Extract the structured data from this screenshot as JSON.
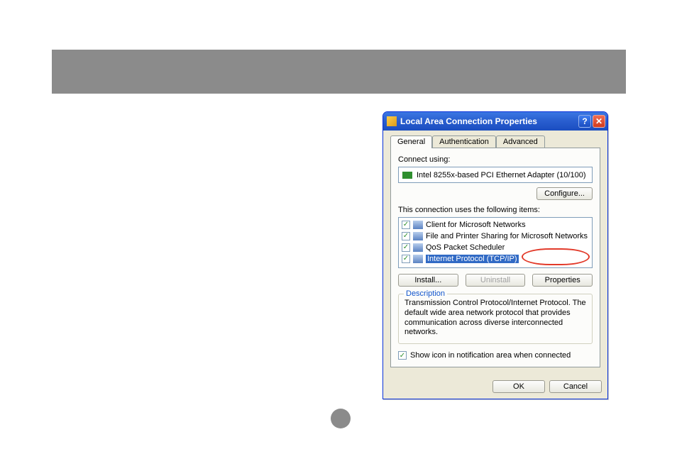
{
  "titlebar": {
    "title": "Local Area Connection Properties"
  },
  "tabs": {
    "general": "General",
    "authentication": "Authentication",
    "advanced": "Advanced"
  },
  "general": {
    "connect_using_label": "Connect using:",
    "adapter_name": "Intel 8255x-based PCI Ethernet Adapter (10/100)",
    "configure_btn": "Configure...",
    "items_label": "This connection uses the following items:",
    "items": [
      {
        "label": "Client for Microsoft Networks",
        "checked": true,
        "selected": false
      },
      {
        "label": "File and Printer Sharing for Microsoft Networks",
        "checked": true,
        "selected": false
      },
      {
        "label": "QoS Packet Scheduler",
        "checked": true,
        "selected": false
      },
      {
        "label": "Internet Protocol (TCP/IP)",
        "checked": true,
        "selected": true
      }
    ],
    "install_btn": "Install...",
    "uninstall_btn": "Uninstall",
    "properties_btn": "Properties",
    "description_legend": "Description",
    "description_text": "Transmission Control Protocol/Internet Protocol. The default wide area network protocol that provides communication across diverse interconnected networks.",
    "notify_label": "Show icon in notification area when connected",
    "notify_checked": true
  },
  "footer": {
    "ok": "OK",
    "cancel": "Cancel"
  }
}
